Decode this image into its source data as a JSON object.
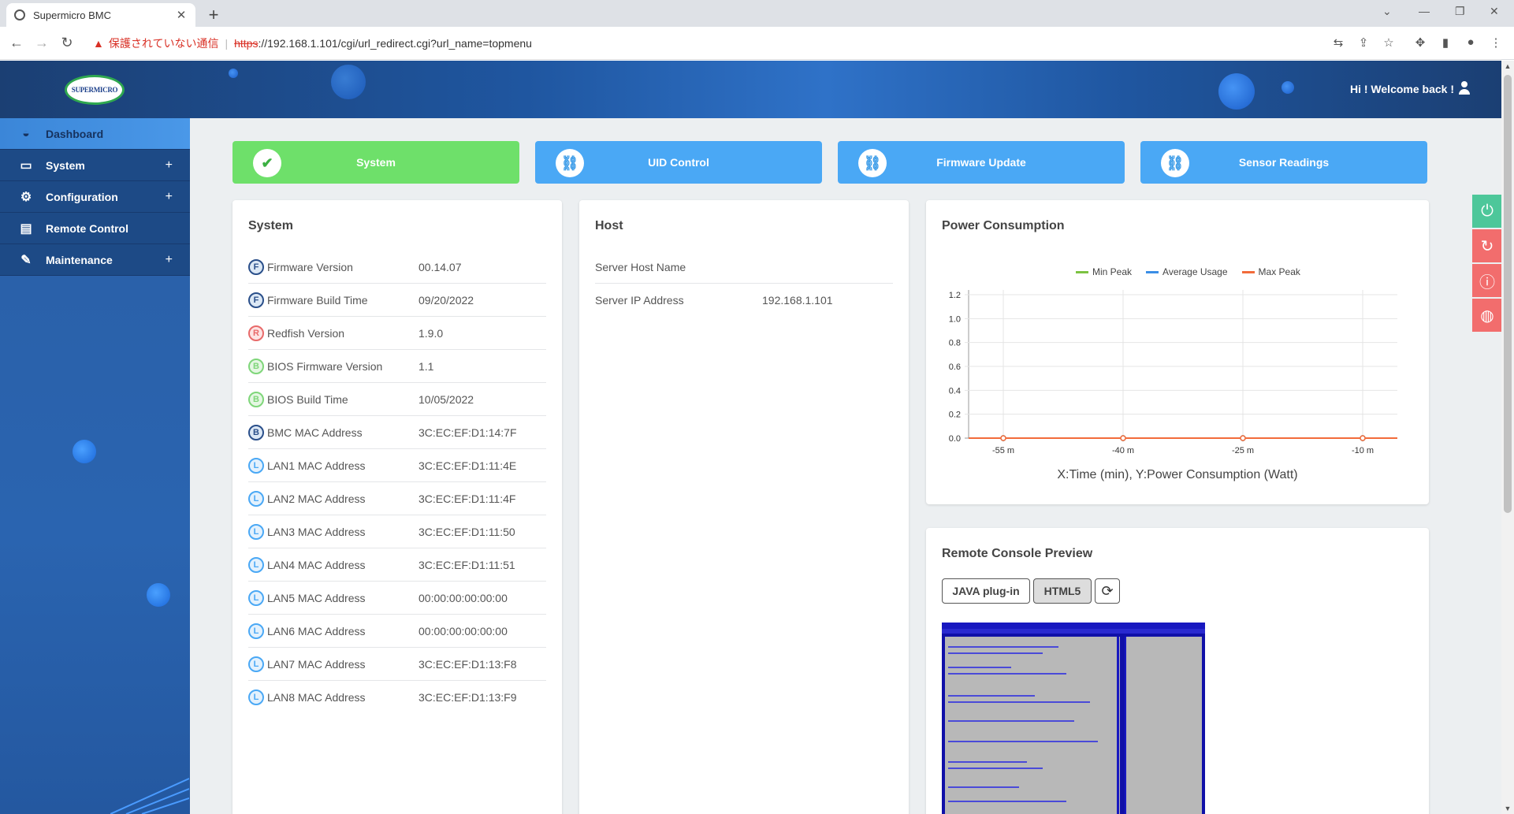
{
  "browser": {
    "tab_title": "Supermicro BMC",
    "tab_close": "✕",
    "new_tab": "+",
    "security_warning": "保護されていない通信",
    "url_scheme": "https",
    "url_rest": "://192.168.1.101/cgi/url_redirect.cgi?url_name=topmenu"
  },
  "header": {
    "logo_text": "SUPERMICRO",
    "welcome": "Hi ! Welcome back !"
  },
  "sidebar": {
    "items": [
      {
        "label": "Dashboard",
        "icon": "gauge-icon"
      },
      {
        "label": "System",
        "icon": "laptop-icon",
        "expand": "+"
      },
      {
        "label": "Configuration",
        "icon": "gear-icon",
        "expand": "+"
      },
      {
        "label": "Remote Control",
        "icon": "terminal-icon"
      },
      {
        "label": "Maintenance",
        "icon": "wrench-icon",
        "expand": "+"
      }
    ]
  },
  "quick": {
    "system": "System",
    "uid": "UID Control",
    "firmware": "Firmware Update",
    "sensor": "Sensor Readings"
  },
  "system_card": {
    "title": "System",
    "rows": [
      {
        "badge": "F",
        "label": "Firmware Version",
        "value": "00.14.07"
      },
      {
        "badge": "F",
        "label": "Firmware Build Time",
        "value": "09/20/2022"
      },
      {
        "badge": "R",
        "label": "Redfish Version",
        "value": "1.9.0"
      },
      {
        "badge": "B",
        "label": "BIOS Firmware Version",
        "value": "1.1"
      },
      {
        "badge": "B",
        "label": "BIOS Build Time",
        "value": "10/05/2022"
      },
      {
        "badge": "B",
        "label": "BMC MAC Address",
        "value": "3C:EC:EF:D1:14:7F"
      },
      {
        "badge": "L",
        "label": "LAN1 MAC Address",
        "value": "3C:EC:EF:D1:11:4E"
      },
      {
        "badge": "L",
        "label": "LAN2 MAC Address",
        "value": "3C:EC:EF:D1:11:4F"
      },
      {
        "badge": "L",
        "label": "LAN3 MAC Address",
        "value": "3C:EC:EF:D1:11:50"
      },
      {
        "badge": "L",
        "label": "LAN4 MAC Address",
        "value": "3C:EC:EF:D1:11:51"
      },
      {
        "badge": "L",
        "label": "LAN5 MAC Address",
        "value": "00:00:00:00:00:00"
      },
      {
        "badge": "L",
        "label": "LAN6 MAC Address",
        "value": "00:00:00:00:00:00"
      },
      {
        "badge": "L",
        "label": "LAN7 MAC Address",
        "value": "3C:EC:EF:D1:13:F8"
      },
      {
        "badge": "L",
        "label": "LAN8 MAC Address",
        "value": "3C:EC:EF:D1:13:F9"
      }
    ]
  },
  "host_card": {
    "title": "Host",
    "rows": [
      {
        "label": "Server Host Name",
        "value": ""
      },
      {
        "label": "Server IP Address",
        "value": "192.168.1.101"
      }
    ]
  },
  "power_card": {
    "title": "Power Consumption"
  },
  "chart_data": {
    "type": "line",
    "title": "",
    "xlabel": "X:Time (min), Y:Power Consumption (Watt)",
    "ylabel": "",
    "x_ticks": [
      "-55 m",
      "-40 m",
      "-25 m",
      "-10 m"
    ],
    "y_ticks": [
      "0.0",
      "0.2",
      "0.4",
      "0.6",
      "0.8",
      "1.0",
      "1.2"
    ],
    "ylim": [
      0,
      1.2
    ],
    "legend_position": "top",
    "series": [
      {
        "name": "Min Peak",
        "color": "#7cc242",
        "values": [
          0,
          0,
          0,
          0
        ]
      },
      {
        "name": "Average Usage",
        "color": "#3a8ee6",
        "values": [
          0,
          0,
          0,
          0
        ]
      },
      {
        "name": "Max Peak",
        "color": "#f26b3a",
        "values": [
          0,
          0,
          0,
          0
        ]
      }
    ]
  },
  "console_card": {
    "title": "Remote Console Preview",
    "java_btn": "JAVA plug-in",
    "html5_btn": "HTML5"
  }
}
